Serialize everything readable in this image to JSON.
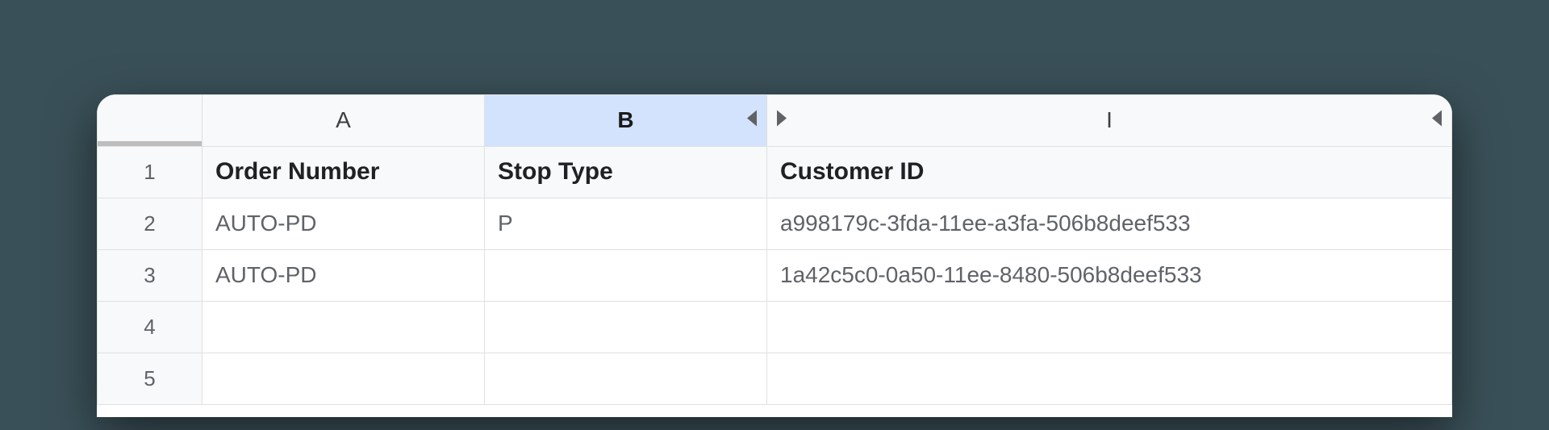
{
  "columns": {
    "a": "A",
    "b": "B",
    "i": "I"
  },
  "row_numbers": [
    "1",
    "2",
    "3",
    "4",
    "5"
  ],
  "headers": {
    "order_number": "Order Number",
    "stop_type": "Stop Type",
    "customer_id": "Customer ID"
  },
  "rows": [
    {
      "order_number": "AUTO-PD",
      "stop_type": "P",
      "customer_id": "a998179c-3fda-11ee-a3fa-506b8deef533"
    },
    {
      "order_number": "AUTO-PD",
      "stop_type": "",
      "customer_id": "1a42c5c0-0a50-11ee-8480-506b8deef533"
    },
    {
      "order_number": "",
      "stop_type": "",
      "customer_id": ""
    },
    {
      "order_number": "",
      "stop_type": "",
      "customer_id": ""
    }
  ]
}
